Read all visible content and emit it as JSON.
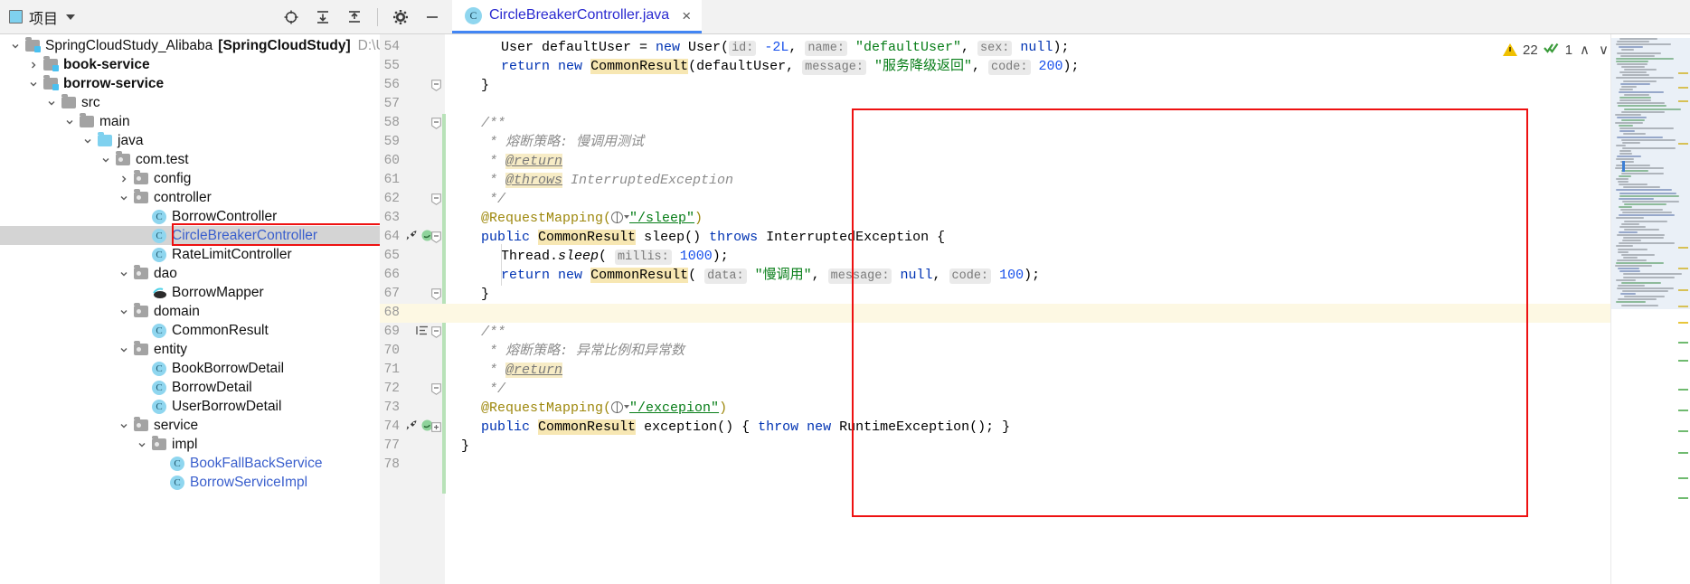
{
  "window": {
    "toolwindow_title": "项目",
    "toolbar_icons": [
      "locate-target-icon",
      "expand-all-icon",
      "collapse-all-icon",
      "settings-gear-icon",
      "hide-toolwindow-icon"
    ]
  },
  "tabs": [
    {
      "label": "CircleBreakerController.java",
      "icon": "java-class-icon",
      "close": "×",
      "active": true
    }
  ],
  "tree": [
    {
      "id": "root",
      "indent": 0,
      "arrow": "down",
      "icon": "project-module-icon",
      "label": "SpringCloudStudy_Alibaba",
      "bold_suffix": "[SpringCloudStudy]",
      "path": "D:\\Users\\Yua",
      "bold": false,
      "selected": false
    },
    {
      "id": "book",
      "indent": 1,
      "arrow": "right",
      "icon": "module-icon",
      "label": "book-service",
      "bold": true,
      "selected": false
    },
    {
      "id": "borrow",
      "indent": 1,
      "arrow": "down",
      "icon": "module-icon",
      "label": "borrow-service",
      "bold": true,
      "selected": false
    },
    {
      "id": "src",
      "indent": 2,
      "arrow": "down",
      "icon": "folder-gray-icon",
      "label": "src",
      "bold": false,
      "selected": false
    },
    {
      "id": "mainfolder",
      "indent": 3,
      "arrow": "down",
      "icon": "folder-gray-icon",
      "label": "main",
      "bold": false,
      "selected": false
    },
    {
      "id": "java",
      "indent": 4,
      "arrow": "down",
      "icon": "folder-source-icon",
      "label": "java",
      "bold": false,
      "selected": false
    },
    {
      "id": "comtest",
      "indent": 5,
      "arrow": "down",
      "icon": "package-icon",
      "label": "com.test",
      "bold": false,
      "selected": false
    },
    {
      "id": "config",
      "indent": 6,
      "arrow": "right",
      "icon": "package-icon",
      "label": "config",
      "bold": false,
      "selected": false
    },
    {
      "id": "controller",
      "indent": 6,
      "arrow": "down",
      "icon": "package-icon",
      "label": "controller",
      "bold": false,
      "selected": false
    },
    {
      "id": "borrowctl",
      "indent": 7,
      "arrow": "none",
      "icon": "java-class-icon",
      "label": "BorrowController",
      "bold": false,
      "selected": false
    },
    {
      "id": "circlectl",
      "indent": 7,
      "arrow": "none",
      "icon": "java-class-icon",
      "label": "CircleBreakerController",
      "bold": false,
      "selected": true,
      "highlighted": true
    },
    {
      "id": "ratectl",
      "indent": 7,
      "arrow": "none",
      "icon": "java-class-icon",
      "label": "RateLimitController",
      "bold": false,
      "selected": false
    },
    {
      "id": "dao",
      "indent": 6,
      "arrow": "down",
      "icon": "package-icon",
      "label": "dao",
      "bold": false,
      "selected": false
    },
    {
      "id": "borrowmap",
      "indent": 7,
      "arrow": "none",
      "icon": "mybatis-mapper-icon",
      "label": "BorrowMapper",
      "bold": false,
      "selected": false
    },
    {
      "id": "domain",
      "indent": 6,
      "arrow": "down",
      "icon": "package-icon",
      "label": "domain",
      "bold": false,
      "selected": false
    },
    {
      "id": "commonresult",
      "indent": 7,
      "arrow": "none",
      "icon": "java-class-icon",
      "label": "CommonResult",
      "bold": false,
      "selected": false
    },
    {
      "id": "entity",
      "indent": 6,
      "arrow": "down",
      "icon": "package-icon",
      "label": "entity",
      "bold": false,
      "selected": false
    },
    {
      "id": "bookborrow",
      "indent": 7,
      "arrow": "none",
      "icon": "java-class-icon",
      "label": "BookBorrowDetail",
      "bold": false,
      "selected": false
    },
    {
      "id": "borrowdet",
      "indent": 7,
      "arrow": "none",
      "icon": "java-class-icon",
      "label": "BorrowDetail",
      "bold": false,
      "selected": false
    },
    {
      "id": "userborrow",
      "indent": 7,
      "arrow": "none",
      "icon": "java-class-icon",
      "label": "UserBorrowDetail",
      "bold": false,
      "selected": false
    },
    {
      "id": "service",
      "indent": 6,
      "arrow": "down",
      "icon": "package-icon",
      "label": "service",
      "bold": false,
      "selected": false
    },
    {
      "id": "impl",
      "indent": 7,
      "arrow": "down",
      "icon": "package-icon",
      "label": "impl",
      "bold": false,
      "selected": false
    },
    {
      "id": "bookfall",
      "indent": 8,
      "arrow": "none",
      "icon": "java-class-icon",
      "label": "BookFallBackService",
      "bold": false,
      "selected": false,
      "blue": true
    },
    {
      "id": "borrowsvc",
      "indent": 8,
      "arrow": "none",
      "icon": "java-class-icon",
      "label": "BorrowServiceImpl",
      "bold": false,
      "selected": false,
      "blue": true
    }
  ],
  "editor": {
    "first_line": 54,
    "highlighted_line": 68,
    "lines": [
      {
        "n": 54,
        "indent": 2,
        "tokens": [
          {
            "t": "User defaultUser = ",
            "c": ""
          },
          {
            "t": "new",
            "c": "kw"
          },
          {
            "t": " User(",
            "c": ""
          },
          {
            "t": "id:",
            "c": "hint"
          },
          {
            "t": " ",
            "c": ""
          },
          {
            "t": "-2L",
            "c": "num"
          },
          {
            "t": ", ",
            "c": ""
          },
          {
            "t": "name:",
            "c": "hint"
          },
          {
            "t": " ",
            "c": ""
          },
          {
            "t": "\"defaultUser\"",
            "c": "str"
          },
          {
            "t": ", ",
            "c": ""
          },
          {
            "t": "sex:",
            "c": "hint"
          },
          {
            "t": " ",
            "c": ""
          },
          {
            "t": "null",
            "c": "kw"
          },
          {
            "t": ");",
            "c": ""
          }
        ]
      },
      {
        "n": 55,
        "indent": 2,
        "tokens": [
          {
            "t": "return",
            "c": "kw"
          },
          {
            "t": " ",
            "c": ""
          },
          {
            "t": "new",
            "c": "kw"
          },
          {
            "t": " ",
            "c": ""
          },
          {
            "t": "CommonResult",
            "c": "occ"
          },
          {
            "t": "(defaultUser, ",
            "c": ""
          },
          {
            "t": "message:",
            "c": "hint"
          },
          {
            "t": " ",
            "c": ""
          },
          {
            "t": "\"服务降级返回\"",
            "c": "str"
          },
          {
            "t": ", ",
            "c": ""
          },
          {
            "t": "code:",
            "c": "hint"
          },
          {
            "t": " ",
            "c": ""
          },
          {
            "t": "200",
            "c": "num"
          },
          {
            "t": ");",
            "c": ""
          }
        ]
      },
      {
        "n": 56,
        "indent": 1,
        "tokens": [
          {
            "t": "}",
            "c": ""
          }
        ]
      },
      {
        "n": 57,
        "indent": 0,
        "tokens": []
      },
      {
        "n": 58,
        "indent": 1,
        "tokens": [
          {
            "t": "/**",
            "c": "cmt"
          }
        ]
      },
      {
        "n": 59,
        "indent": 1,
        "tokens": [
          {
            "t": " * ",
            "c": "cmt"
          },
          {
            "t": "熔断策略: 慢调用测试",
            "c": "cmt"
          }
        ]
      },
      {
        "n": 60,
        "indent": 1,
        "tokens": [
          {
            "t": " * ",
            "c": "cmt"
          },
          {
            "t": "@return",
            "c": "jd-tag"
          }
        ]
      },
      {
        "n": 61,
        "indent": 1,
        "tokens": [
          {
            "t": " * ",
            "c": "cmt"
          },
          {
            "t": "@throws",
            "c": "jd-tag"
          },
          {
            "t": " InterruptedException",
            "c": "cmt"
          }
        ]
      },
      {
        "n": 62,
        "indent": 1,
        "tokens": [
          {
            "t": " */",
            "c": "cmt"
          }
        ]
      },
      {
        "n": 63,
        "indent": 1,
        "tokens": [
          {
            "t": "@RequestMapping(",
            "c": "anno"
          },
          {
            "t": "GLOBE",
            "c": "globe"
          },
          {
            "t": "\"/sleep\"",
            "c": "link-str"
          },
          {
            "t": ")",
            "c": "anno"
          }
        ]
      },
      {
        "n": 64,
        "indent": 1,
        "gutter_icons": [
          "run-icon",
          "spring-bean-icon"
        ],
        "tokens": [
          {
            "t": "public",
            "c": "kw"
          },
          {
            "t": " ",
            "c": ""
          },
          {
            "t": "CommonResult",
            "c": "occ"
          },
          {
            "t": " ",
            "c": ""
          },
          {
            "t": "sleep",
            "c": "mono-id"
          },
          {
            "t": "() ",
            "c": ""
          },
          {
            "t": "throws",
            "c": "kw"
          },
          {
            "t": " InterruptedException {",
            "c": ""
          }
        ]
      },
      {
        "n": 65,
        "indent": 2,
        "tokens": [
          {
            "t": "Thread.",
            "c": ""
          },
          {
            "t": "sleep",
            "c": "ital"
          },
          {
            "t": "( ",
            "c": ""
          },
          {
            "t": "millis:",
            "c": "hint"
          },
          {
            "t": " ",
            "c": ""
          },
          {
            "t": "1000",
            "c": "num"
          },
          {
            "t": ");",
            "c": ""
          }
        ]
      },
      {
        "n": 66,
        "indent": 2,
        "tokens": [
          {
            "t": "return",
            "c": "kw"
          },
          {
            "t": " ",
            "c": ""
          },
          {
            "t": "new",
            "c": "kw"
          },
          {
            "t": " ",
            "c": ""
          },
          {
            "t": "CommonResult",
            "c": "occ"
          },
          {
            "t": "( ",
            "c": ""
          },
          {
            "t": "data:",
            "c": "hint"
          },
          {
            "t": " ",
            "c": ""
          },
          {
            "t": "\"慢调用\"",
            "c": "str"
          },
          {
            "t": ", ",
            "c": ""
          },
          {
            "t": "message:",
            "c": "hint"
          },
          {
            "t": " ",
            "c": ""
          },
          {
            "t": "null",
            "c": "kw"
          },
          {
            "t": ", ",
            "c": ""
          },
          {
            "t": "code:",
            "c": "hint"
          },
          {
            "t": " ",
            "c": ""
          },
          {
            "t": "100",
            "c": "num"
          },
          {
            "t": ");",
            "c": ""
          }
        ]
      },
      {
        "n": 67,
        "indent": 1,
        "tokens": [
          {
            "t": "}",
            "c": ""
          }
        ]
      },
      {
        "n": 68,
        "indent": 0,
        "tokens": []
      },
      {
        "n": 69,
        "indent": 1,
        "gutter_icons": [
          "format-marker-icon"
        ],
        "tokens": [
          {
            "t": "/**",
            "c": "cmt"
          }
        ]
      },
      {
        "n": 70,
        "indent": 1,
        "tokens": [
          {
            "t": " * ",
            "c": "cmt"
          },
          {
            "t": "熔断策略: 异常比例和异常数",
            "c": "cmt"
          }
        ]
      },
      {
        "n": 71,
        "indent": 1,
        "tokens": [
          {
            "t": " * ",
            "c": "cmt"
          },
          {
            "t": "@return",
            "c": "jd-tag"
          }
        ]
      },
      {
        "n": 72,
        "indent": 1,
        "tokens": [
          {
            "t": " */",
            "c": "cmt"
          }
        ]
      },
      {
        "n": 73,
        "indent": 1,
        "tokens": [
          {
            "t": "@RequestMapping(",
            "c": "anno"
          },
          {
            "t": "GLOBE",
            "c": "globe"
          },
          {
            "t": "\"/excepion\"",
            "c": "link-str"
          },
          {
            "t": ")",
            "c": "anno"
          }
        ]
      },
      {
        "n": 74,
        "indent": 1,
        "gutter_icons": [
          "run-icon",
          "spring-bean-icon"
        ],
        "tokens": [
          {
            "t": "public",
            "c": "kw"
          },
          {
            "t": " ",
            "c": ""
          },
          {
            "t": "CommonResult",
            "c": "occ"
          },
          {
            "t": " ",
            "c": ""
          },
          {
            "t": "exception",
            "c": "mono-id"
          },
          {
            "t": "() { ",
            "c": ""
          },
          {
            "t": "throw",
            "c": "kw"
          },
          {
            "t": " ",
            "c": ""
          },
          {
            "t": "new",
            "c": "kw"
          },
          {
            "t": " RuntimeException(); }",
            "c": ""
          }
        ]
      },
      {
        "n": 77,
        "indent": 0,
        "tokens": [
          {
            "t": "}",
            "c": ""
          }
        ]
      },
      {
        "n": 78,
        "indent": 0,
        "tokens": []
      }
    ],
    "annotation_box": {
      "label": "red-highlight-rectangle",
      "color": "#ee1111"
    }
  },
  "inspections": {
    "warning_count": "22",
    "warning_icon": "warning-triangle-icon",
    "typo_count": "1",
    "typo_icon": "spellcheck-icon",
    "prev_label": "∧",
    "next_label": "∨"
  },
  "colors": {
    "accent_blue": "#4285f4",
    "warning_yellow": "#f0c000",
    "red_annotation": "#ee1111",
    "selection_gray": "#d4d4d4",
    "highlight_line": "#fdf8e3"
  }
}
